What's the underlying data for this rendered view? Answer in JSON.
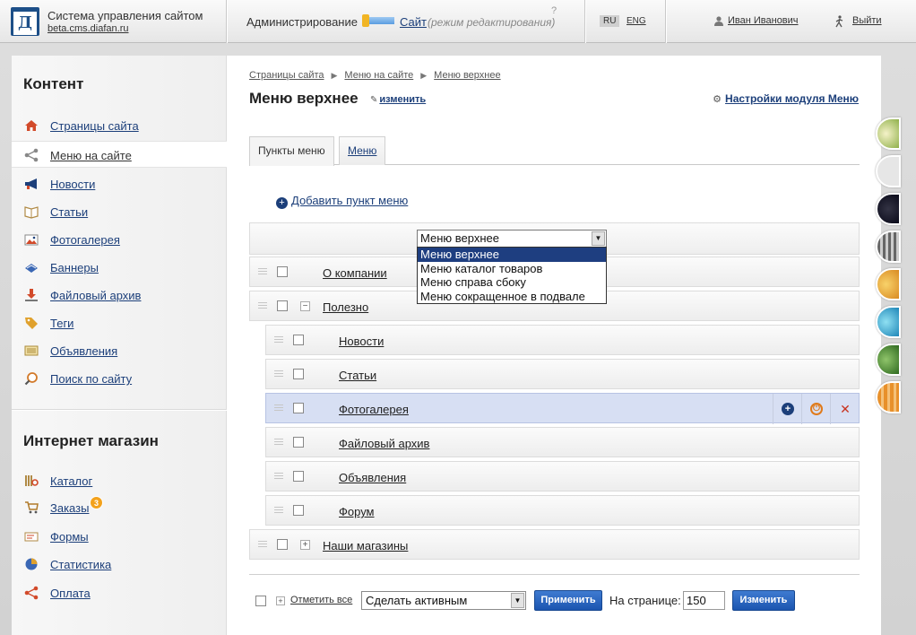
{
  "header": {
    "site_title": "Система управления сайтом",
    "site_url": "beta.cms.diafan.ru",
    "admin_label": "Администрирование",
    "site_link": "Сайт",
    "site_mode": "(режим редактирования)",
    "help": "?",
    "lang_ru": "RU",
    "lang_en": "ENG",
    "user_name": "Иван Иванович",
    "exit": "Выйти"
  },
  "sidebar": {
    "content_heading": "Контент",
    "content_items": [
      {
        "label": "Страницы сайта",
        "icon": "home-icon"
      },
      {
        "label": "Меню на сайте",
        "icon": "share-icon"
      },
      {
        "label": "Новости",
        "icon": "megaphone-icon"
      },
      {
        "label": "Статьи",
        "icon": "book-icon"
      },
      {
        "label": "Фотогалерея",
        "icon": "photo-icon"
      },
      {
        "label": "Баннеры",
        "icon": "banner-icon"
      },
      {
        "label": "Файловый архив",
        "icon": "download-icon"
      },
      {
        "label": "Теги",
        "icon": "tag-icon"
      },
      {
        "label": "Объявления",
        "icon": "ads-icon"
      },
      {
        "label": "Поиск по сайту",
        "icon": "search-icon"
      }
    ],
    "shop_heading": "Интернет магазин",
    "shop_items": [
      {
        "label": "Каталог",
        "icon": "catalog-icon"
      },
      {
        "label": "Заказы",
        "icon": "cart-icon",
        "badge": "3"
      },
      {
        "label": "Формы",
        "icon": "form-icon"
      },
      {
        "label": "Статистика",
        "icon": "pie-icon"
      },
      {
        "label": "Оплата",
        "icon": "payment-icon"
      }
    ]
  },
  "main": {
    "breadcrumb": [
      "Страницы сайта",
      "Меню на сайте",
      "Меню верхнее"
    ],
    "title": "Меню верхнее",
    "edit_link": "изменить",
    "settings_link": "Настройки модуля Меню",
    "tabs": [
      "Пункты меню",
      "Меню"
    ],
    "add_item": "Добавить пункт меню",
    "menu_select": {
      "value": "Меню верхнее",
      "options": [
        "Меню верхнее",
        "Меню каталог товаров",
        "Меню справа сбоку",
        "Меню сокращенное в подвале"
      ]
    },
    "rows": [
      {
        "name": "О компании",
        "level": 0,
        "expander": ""
      },
      {
        "name": "Полезно",
        "level": 0,
        "expander": "⊟"
      },
      {
        "name": "Новости",
        "level": 1,
        "expander": ""
      },
      {
        "name": "Статьи",
        "level": 1,
        "expander": ""
      },
      {
        "name": "Фотогалерея",
        "level": 1,
        "expander": "",
        "selected": true
      },
      {
        "name": "Файловый архив",
        "level": 1,
        "expander": ""
      },
      {
        "name": "Объявления",
        "level": 1,
        "expander": ""
      },
      {
        "name": "Форум",
        "level": 1,
        "expander": ""
      },
      {
        "name": "Наши магазины",
        "level": 0,
        "expander": "⊞"
      }
    ],
    "bulk": {
      "select_all": "Отметить все",
      "action": "Сделать активным",
      "apply": "Применить",
      "per_page_label": "На странице:",
      "per_page_value": "150",
      "change": "Изменить"
    }
  },
  "colors": {
    "accent": "#1c3f7a",
    "selected_row": "#d7dff3",
    "button": "#2560bd",
    "badge": "#f3a21c"
  }
}
